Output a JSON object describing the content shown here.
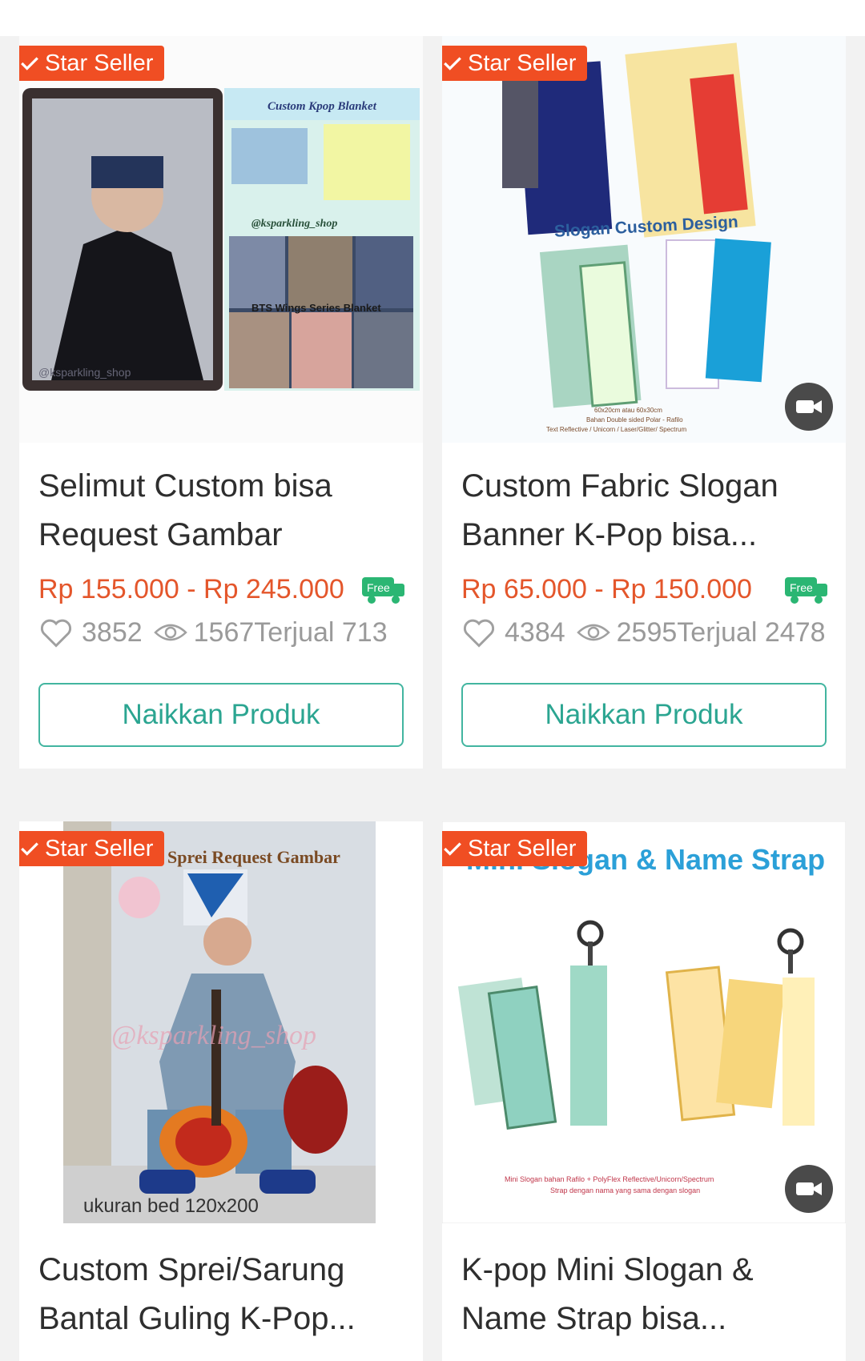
{
  "badge_label": "Star Seller",
  "products": [
    {
      "title": "Selimut Custom bisa Request Gambar",
      "price": "Rp 155.000 - Rp 245.000",
      "free_label": "Free",
      "likes": "3852",
      "views": "1567",
      "sold": "Terjual 713",
      "button": "Naikkan Produk",
      "image_texts": [
        "Custom Kpop Blanket",
        "@ksparkling_shop",
        "BTS Wings Series Blanket",
        "@ksparkling_shop"
      ]
    },
    {
      "title": "Custom Fabric Slogan Banner K-Pop bisa...",
      "price": "Rp 65.000 - Rp 150.000",
      "free_label": "Free",
      "likes": "4384",
      "views": "2595",
      "sold": "Terjual 2478",
      "button": "Naikkan Produk",
      "has_video": true,
      "image_texts": [
        "Slogan Custom Design",
        "60x20cm atau 60x30cm",
        "Bahan Double sided Polar - Rafilo",
        "Text Reflective / Unicorn / Laser/Glitter/ Spectrum"
      ]
    },
    {
      "title": "Custom Sprei/Sarung Bantal Guling K-Pop...",
      "image_texts": [
        "Sprei Request Gambar",
        "@ksparkling_shop",
        "ukuran bed 120x200"
      ]
    },
    {
      "title": "K-pop Mini Slogan & Name Strap bisa...",
      "has_video": true,
      "image_texts": [
        "Mini Slogan & Name Strap",
        "Mini Slogan bahan Rafilo + PolyFlex Reflective/Unicorn/Spectrum",
        "Strap dengan nama yang sama dengan slogan"
      ]
    }
  ],
  "colors": {
    "badge": "#f04e23",
    "price": "#e4562b",
    "accent": "#42b5a0",
    "free_truck": "#2bb673"
  }
}
